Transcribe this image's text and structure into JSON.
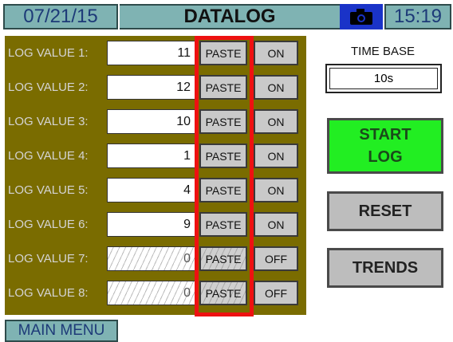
{
  "header": {
    "date": "07/21/15",
    "title": "DATALOG",
    "time": "15:19",
    "camera_icon": "camera-icon"
  },
  "rows": [
    {
      "label": "LOG VALUE 1:",
      "value": "11",
      "paste": "PASTE",
      "state": "ON"
    },
    {
      "label": "LOG VALUE 2:",
      "value": "12",
      "paste": "PASTE",
      "state": "ON"
    },
    {
      "label": "LOG VALUE 3:",
      "value": "10",
      "paste": "PASTE",
      "state": "ON"
    },
    {
      "label": "LOG VALUE 4:",
      "value": "1",
      "paste": "PASTE",
      "state": "ON"
    },
    {
      "label": "LOG VALUE 5:",
      "value": "4",
      "paste": "PASTE",
      "state": "ON"
    },
    {
      "label": "LOG VALUE 6:",
      "value": "9",
      "paste": "PASTE",
      "state": "ON"
    },
    {
      "label": "LOG VALUE 7:",
      "value": "0",
      "paste": "PASTE",
      "state": "OFF"
    },
    {
      "label": "LOG VALUE 8:",
      "value": "0",
      "paste": "PASTE",
      "state": "OFF"
    }
  ],
  "time_base": {
    "label": "TIME BASE",
    "value": "10s"
  },
  "buttons": {
    "start": "START LOG",
    "reset": "RESET",
    "trends": "TRENDS",
    "main_menu": "MAIN MENU"
  },
  "colors": {
    "panel": "#7a6c00",
    "header": "#7fb3b3",
    "start": "#22ee22",
    "highlight": "#ee1111"
  }
}
